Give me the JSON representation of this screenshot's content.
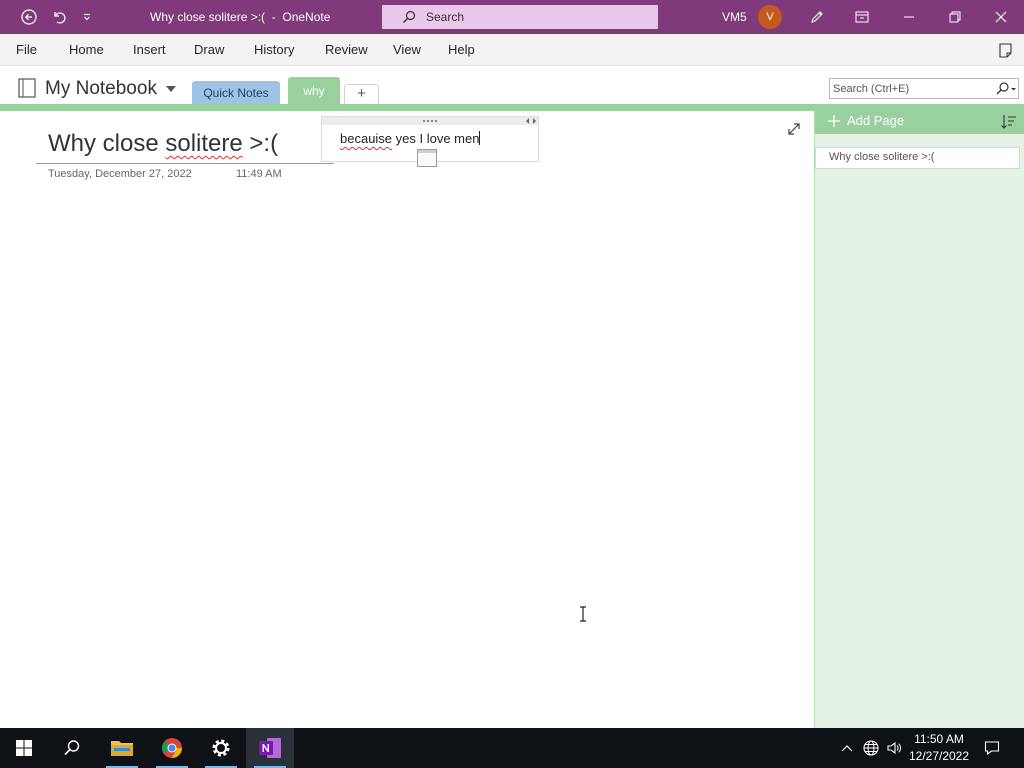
{
  "titlebar": {
    "title": "Why close solitere >:(  -  OneNote",
    "search_placeholder": "Search",
    "user_name": "VM5",
    "avatar_initial": "V"
  },
  "menu": {
    "items": [
      "File",
      "Home",
      "Insert",
      "Draw",
      "History",
      "Review",
      "View",
      "Help"
    ]
  },
  "notebook": {
    "name": "My Notebook",
    "sections": [
      "Quick Notes",
      "why"
    ],
    "add_section_label": "+",
    "search_placeholder": "Search (Ctrl+E)"
  },
  "page": {
    "title_prefix": "Why close ",
    "title_misspelled": "solitere",
    "title_suffix": " >:(",
    "date": "Tuesday, December 27, 2022",
    "time": "11:49 AM",
    "note_misspelled": "becauise",
    "note_rest": " yes I love men"
  },
  "pages_pane": {
    "add_page_label": "Add Page",
    "pages": [
      "Why close solitere >:("
    ]
  },
  "taskbar": {
    "time": "11:50 AM",
    "date": "12/27/2022"
  },
  "colors": {
    "onenote_purple": "#80397b",
    "section_green": "#99d19e",
    "quick_notes_blue": "#9dc3e6"
  }
}
